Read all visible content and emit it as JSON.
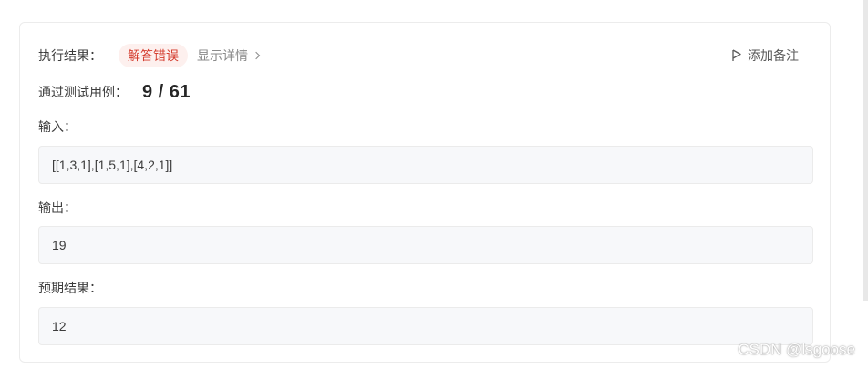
{
  "result": {
    "label": "执行结果：",
    "status": "解答错误",
    "details_link": "显示详情",
    "add_note": "添加备注"
  },
  "pass": {
    "label": "通过测试用例：",
    "count": "9  /  61"
  },
  "input": {
    "label": "输入：",
    "value": "[[1,3,1],[1,5,1],[4,2,1]]"
  },
  "output": {
    "label": "输出：",
    "value": "19"
  },
  "expected": {
    "label": "预期结果：",
    "value": "12"
  },
  "watermark": "CSDN @lsgoose",
  "colors": {
    "error": "#d43c2e",
    "error_bg": "#fdf0ee",
    "codebox_bg": "#f7f8fa"
  }
}
